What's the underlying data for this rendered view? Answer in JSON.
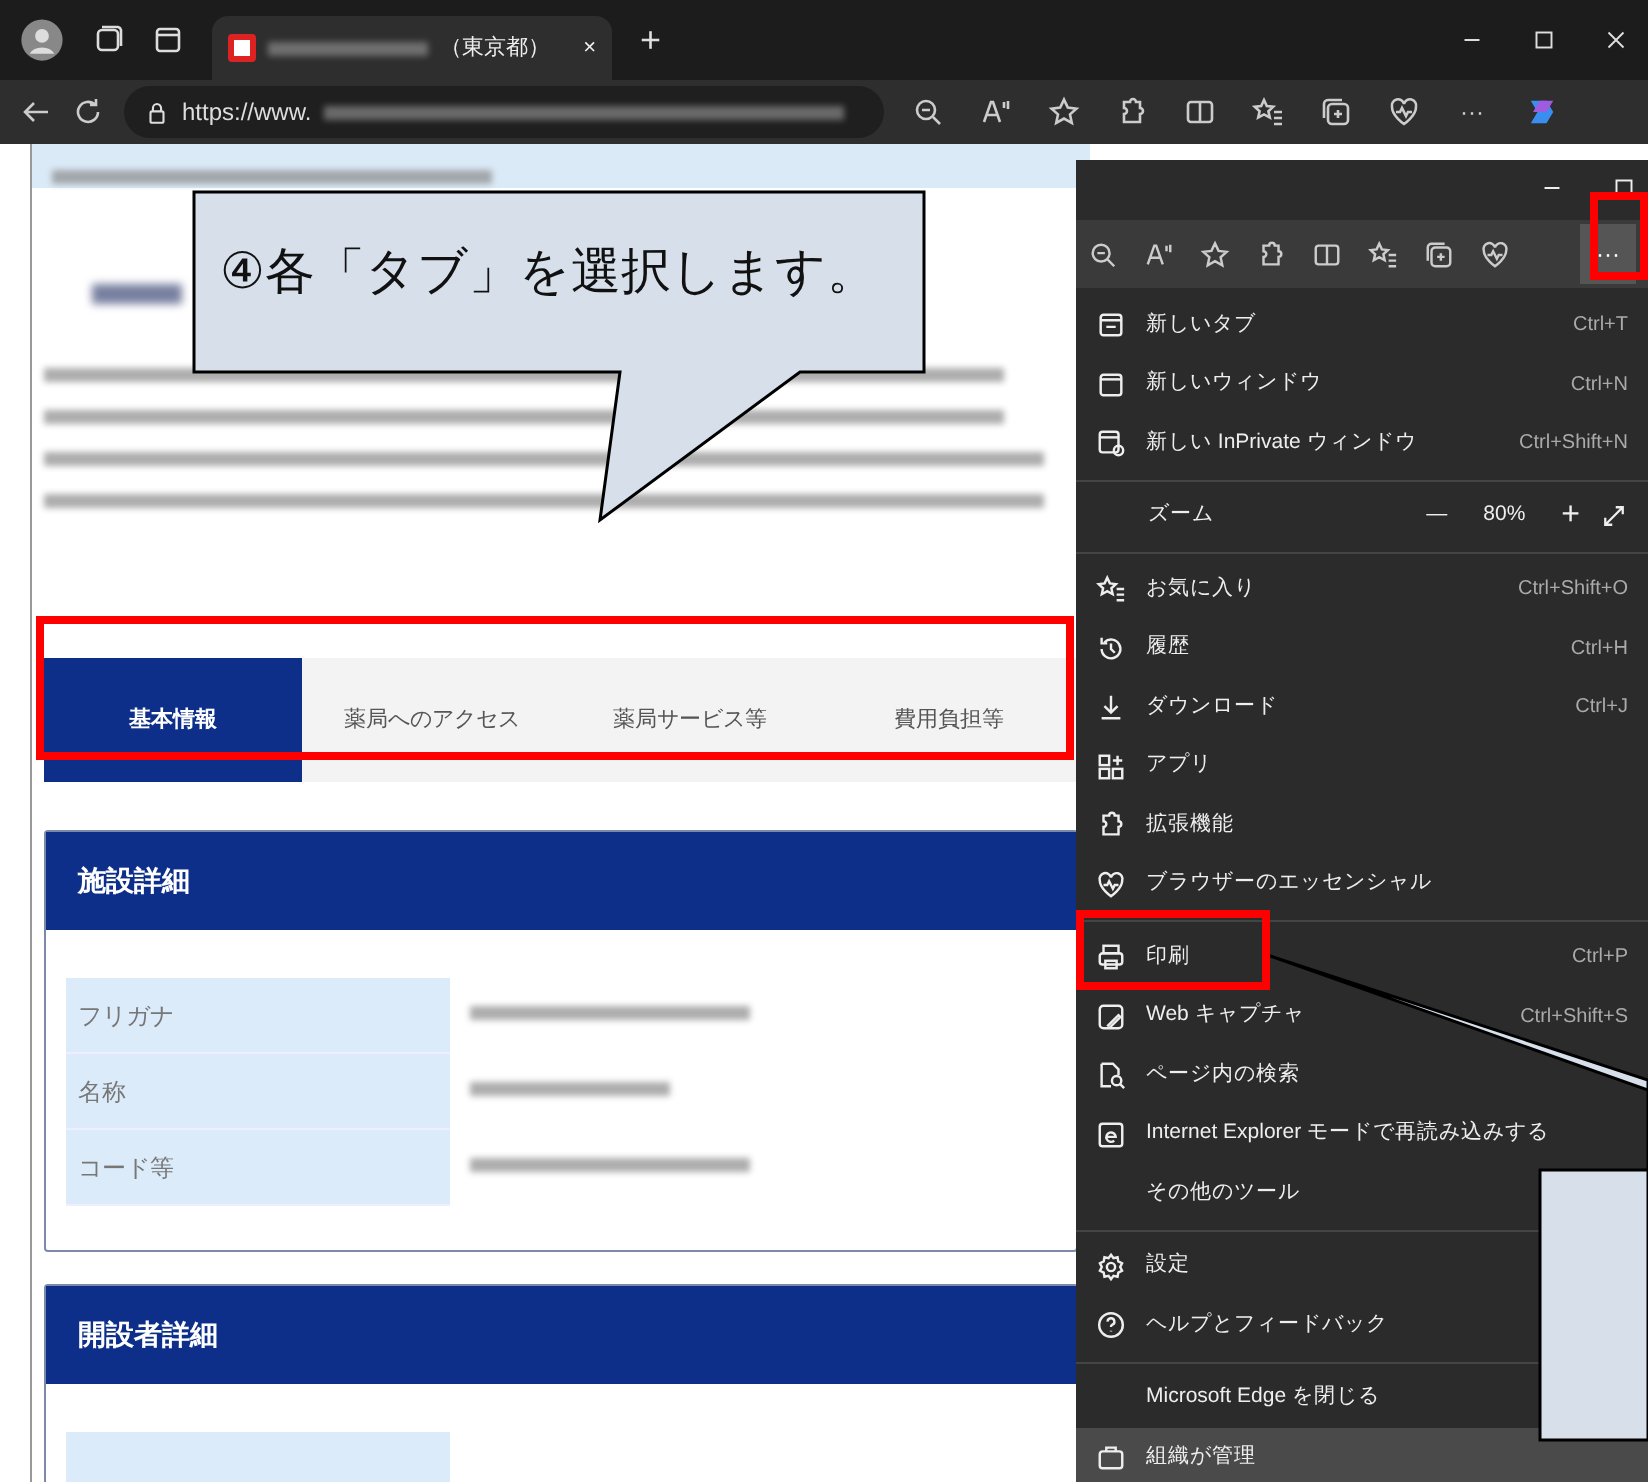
{
  "browser": {
    "tab_title": "（東京都）",
    "tab_close": "×",
    "new_tab": "+",
    "url_prefix": "https://www.",
    "more": "···"
  },
  "page": {
    "tabs": [
      {
        "label": "基本情報",
        "selected": true
      },
      {
        "label": "薬局へのアクセス",
        "selected": false
      },
      {
        "label": "薬局サービス等",
        "selected": false
      },
      {
        "label": "費用負担等",
        "selected": false
      }
    ],
    "sections": [
      {
        "title": "施設詳細",
        "rows": [
          {
            "label": "フリガナ"
          },
          {
            "label": "名称"
          },
          {
            "label": "コード等"
          }
        ]
      },
      {
        "title": "開設者詳細"
      }
    ]
  },
  "menu_window": {
    "more": "···",
    "items": [
      {
        "kind": "item",
        "label": "新しいタブ",
        "shortcut": "Ctrl+T"
      },
      {
        "kind": "item",
        "label": "新しいウィンドウ",
        "shortcut": "Ctrl+N"
      },
      {
        "kind": "item",
        "label": "新しい InPrivate ウィンドウ",
        "shortcut": "Ctrl+Shift+N"
      },
      {
        "kind": "divider"
      },
      {
        "kind": "zoom",
        "label": "ズーム",
        "minus": "—",
        "value": "80%",
        "plus": "+"
      },
      {
        "kind": "divider"
      },
      {
        "kind": "item",
        "label": "お気に入り",
        "shortcut": "Ctrl+Shift+O"
      },
      {
        "kind": "item",
        "label": "履歴",
        "shortcut": "Ctrl+H"
      },
      {
        "kind": "item",
        "label": "ダウンロード",
        "shortcut": "Ctrl+J"
      },
      {
        "kind": "item",
        "label": "アプリ"
      },
      {
        "kind": "item",
        "label": "拡張機能"
      },
      {
        "kind": "item",
        "label": "ブラウザーのエッセンシャル"
      },
      {
        "kind": "divider"
      },
      {
        "kind": "item",
        "label": "印刷",
        "shortcut": "Ctrl+P"
      },
      {
        "kind": "item",
        "label": "Web キャプチャ",
        "shortcut": "Ctrl+Shift+S"
      },
      {
        "kind": "item",
        "label": "ページ内の検索"
      },
      {
        "kind": "item",
        "label": "Internet Explorer モードで再読み込みする"
      },
      {
        "kind": "item",
        "label": "その他のツール"
      },
      {
        "kind": "divider"
      },
      {
        "kind": "item",
        "label": "設定"
      },
      {
        "kind": "item",
        "label": "ヘルプとフィードバック"
      },
      {
        "kind": "divider"
      },
      {
        "kind": "item",
        "label": "Microsoft Edge を閉じる"
      },
      {
        "kind": "footer",
        "label": "組織が管理"
      }
    ]
  },
  "callout": {
    "text": "④各「タブ」を選択します。"
  }
}
